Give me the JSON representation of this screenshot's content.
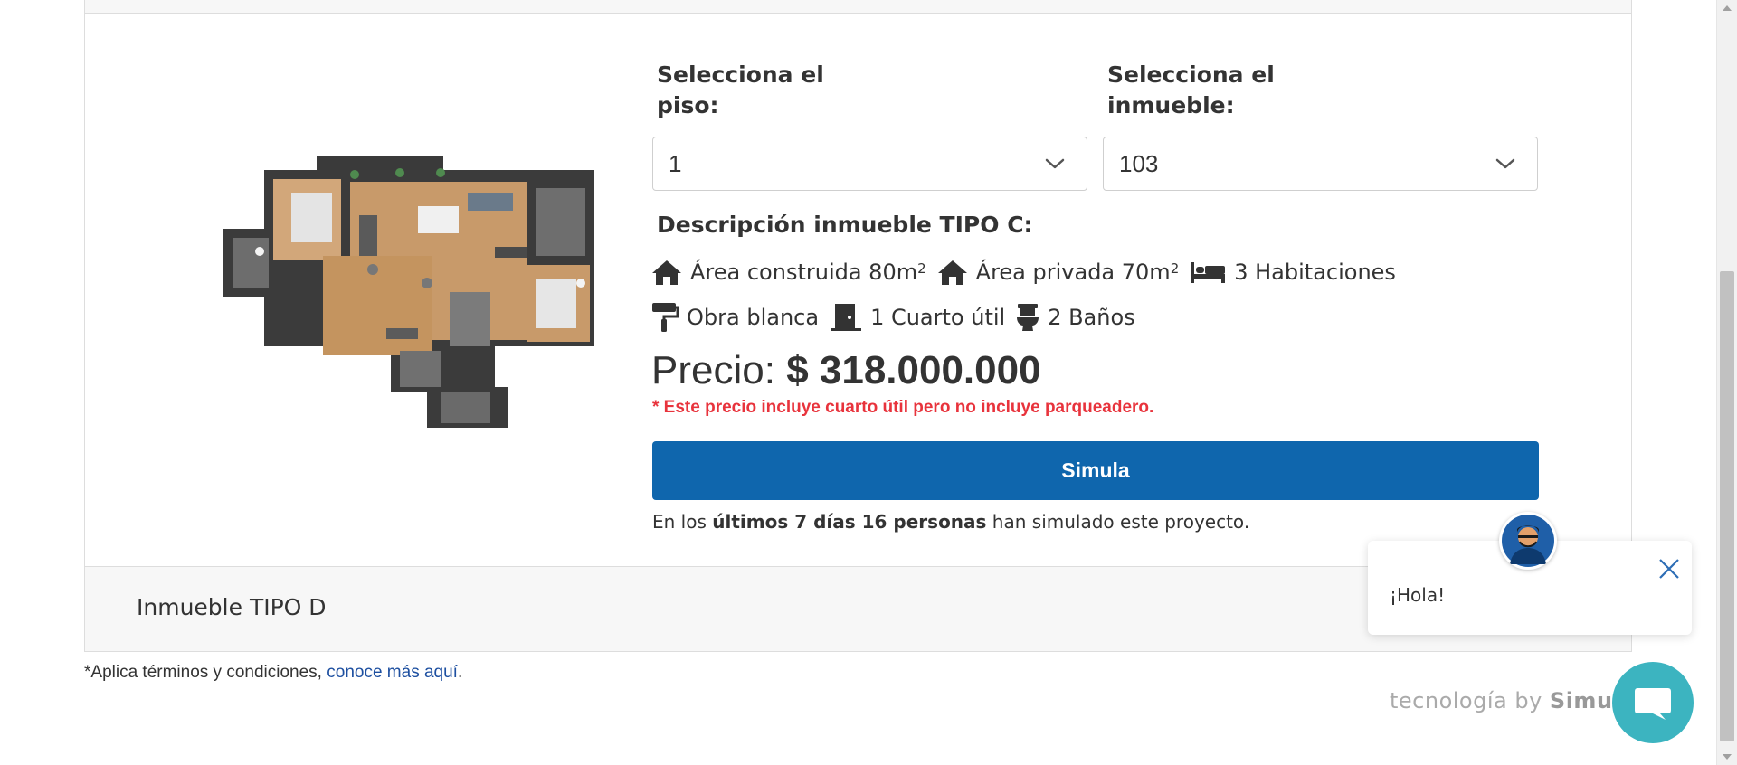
{
  "selectors": {
    "floor_label": "Selecciona el piso:",
    "floor_value": "1",
    "unit_label": "Selecciona el inmueble:",
    "unit_value": "103"
  },
  "description": {
    "title": "Descripción inmueble TIPO C:",
    "features": [
      {
        "icon": "house-icon",
        "text": "Área construida 80m",
        "sup": "2"
      },
      {
        "icon": "house-icon",
        "text": "Área privada 70m",
        "sup": "2"
      },
      {
        "icon": "bed-icon",
        "text": "3 Habitaciones"
      },
      {
        "icon": "paint-roller-icon",
        "text": "Obra blanca"
      },
      {
        "icon": "door-icon",
        "text": "1 Cuarto útil"
      },
      {
        "icon": "toilet-icon",
        "text": "2 Baños"
      }
    ]
  },
  "price": {
    "label": "Precio:",
    "amount": "$ 318.000.000",
    "note": "* Este precio incluye cuarto útil pero no incluye parqueadero."
  },
  "simula": {
    "button_label": "Simula",
    "stats_prefix": "En los ",
    "stats_bold": "últimos 7 días 16 personas",
    "stats_suffix": " han simulado este proyecto."
  },
  "next_unit": {
    "label": "Inmueble TIPO D"
  },
  "footer": {
    "terms_text": "*Aplica términos y condiciones, ",
    "terms_link": "conoce más aquí",
    "terms_end": ".",
    "brand_prefix": "tecnología by ",
    "brand_name": "Simul"
  },
  "chat": {
    "greeting": "¡Hola!"
  },
  "colors": {
    "primary_button": "#0f66ad",
    "price_note": "#e8333c",
    "chat_launcher": "#3cb4c0",
    "link": "#1d4fa0"
  }
}
